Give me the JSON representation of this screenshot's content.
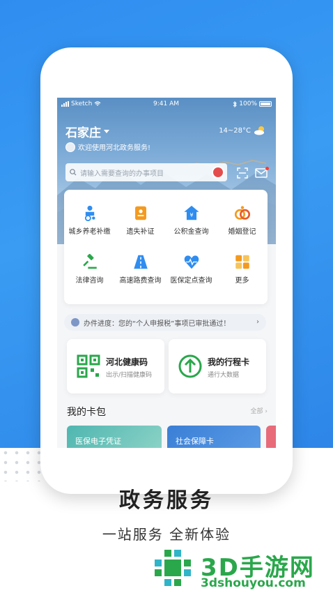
{
  "status": {
    "carrier": "Sketch",
    "time": "9:41 AM",
    "battery": "100%"
  },
  "header": {
    "city": "石家庄",
    "weather": "14~28°C",
    "welcome": "欢迎使用河北政务服务!",
    "search_placeholder": "请输入需要查询的办事项目"
  },
  "services": [
    {
      "label": "城乡养老补缴",
      "icon": "elderly-icon"
    },
    {
      "label": "遗失补证",
      "icon": "document-icon"
    },
    {
      "label": "公积金查询",
      "icon": "house-yuan-icon"
    },
    {
      "label": "婚姻登记",
      "icon": "marriage-icon"
    },
    {
      "label": "法律咨询",
      "icon": "gavel-icon"
    },
    {
      "label": "高速路费查询",
      "icon": "highway-icon"
    },
    {
      "label": "医保定点查询",
      "icon": "heart-pulse-icon"
    },
    {
      "label": "更多",
      "icon": "more-grid-icon"
    }
  ],
  "notice": {
    "text": "办件进度：您的“个人申报税”事项已审批通过！"
  },
  "quick_cards": [
    {
      "title": "河北健康码",
      "subtitle": "出示/扫描健康码"
    },
    {
      "title": "我的行程卡",
      "subtitle": "通行大数据"
    }
  ],
  "wallet": {
    "title": "我的卡包",
    "all_label": "全部",
    "cards": [
      "医保电子凭证",
      "社会保障卡"
    ]
  },
  "captions": {
    "headline": "政务服务",
    "tagline": "一站服务  全新体验"
  },
  "watermark": {
    "brand": "3D手游网",
    "domain": "3dshouyou.com"
  },
  "colors": {
    "accent": "#2f8df0",
    "green": "#2aa74b",
    "orange": "#f39a1f"
  }
}
